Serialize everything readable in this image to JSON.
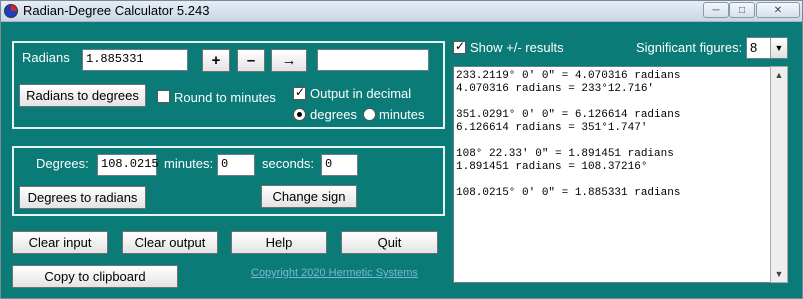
{
  "window": {
    "title": "Radian-Degree Calculator 5.243",
    "minimize": "─",
    "maximize": "□",
    "close": "✕"
  },
  "radians_panel": {
    "label": "Radians",
    "value": "1.885331",
    "plus": "+",
    "minus": "–",
    "arrow": "→",
    "output_value": "",
    "convert_button": "Radians to degrees",
    "round_label": "Round to minutes",
    "round_checked": false,
    "decimal_label": "Output in decimal",
    "decimal_checked": true,
    "radio_degrees": "degrees",
    "radio_minutes": "minutes",
    "selected_radio": "degrees"
  },
  "degrees_panel": {
    "degrees_label": "Degrees:",
    "degrees_value": "108.0215",
    "minutes_label": "minutes:",
    "minutes_value": "0",
    "seconds_label": "seconds:",
    "seconds_value": "0",
    "convert_button": "Degrees to radians",
    "change_sign_button": "Change sign"
  },
  "bottom_buttons": {
    "clear_input": "Clear input",
    "clear_output": "Clear output",
    "help": "Help",
    "quit": "Quit",
    "copy": "Copy to clipboard"
  },
  "copyright": "Copyright 2020 Hermetic Systems",
  "results_panel": {
    "show_pm_label": "Show +/- results",
    "show_pm_checked": true,
    "sig_fig_label": "Significant figures:",
    "sig_fig_value": "8",
    "lines": [
      "233.2119° 0' 0\" = 4.070316 radians",
      "4.070316 radians = 233°12.716'",
      "",
      "351.0291° 0' 0\" = 6.126614 radians",
      "6.126614 radians = 351°1.747'",
      "",
      "108° 22.33' 0\" = 1.891451 radians",
      "1.891451 radians = 108.37216°",
      "",
      "108.0215° 0' 0\" = 1.885331 radians"
    ]
  }
}
